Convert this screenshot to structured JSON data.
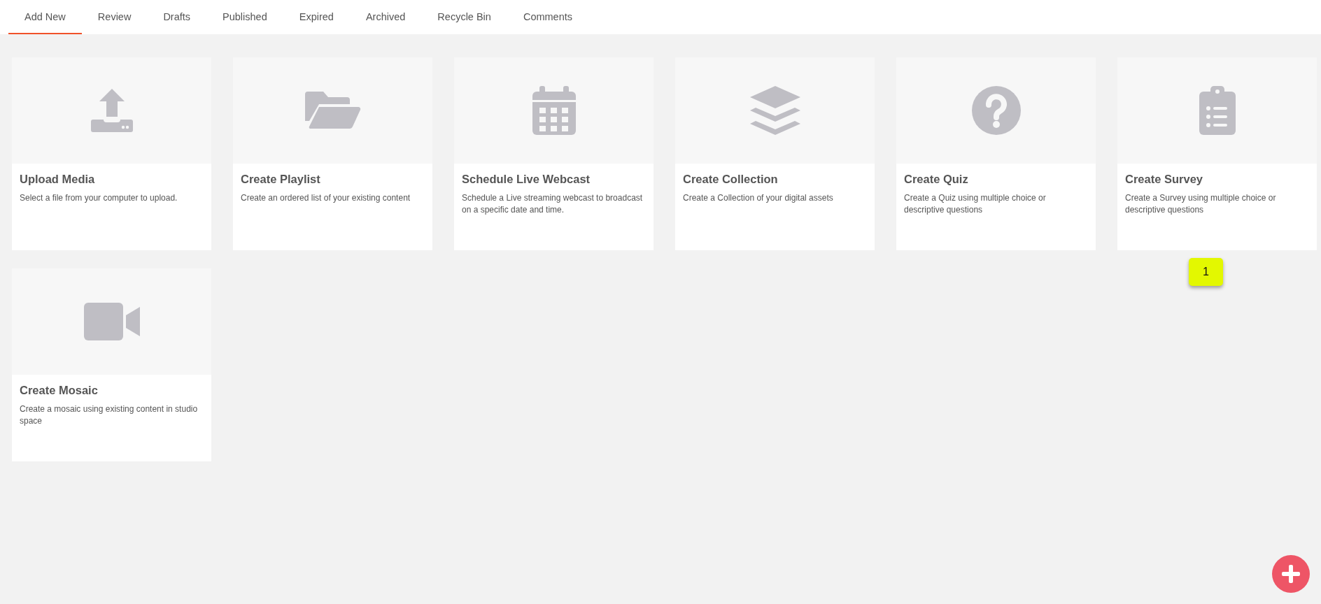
{
  "tabs": [
    {
      "label": "Add New",
      "selected": true
    },
    {
      "label": "Review",
      "selected": false
    },
    {
      "label": "Drafts",
      "selected": false
    },
    {
      "label": "Published",
      "selected": false
    },
    {
      "label": "Expired",
      "selected": false
    },
    {
      "label": "Archived",
      "selected": false
    },
    {
      "label": "Recycle Bin",
      "selected": false
    },
    {
      "label": "Comments",
      "selected": false
    }
  ],
  "cards": [
    {
      "kind": "upload",
      "title": "Upload Media",
      "description": "Select a file from your computer to upload."
    },
    {
      "kind": "folder",
      "title": "Create Playlist",
      "description": "Create an ordered list of your existing content"
    },
    {
      "kind": "calendar",
      "title": "Schedule Live Webcast",
      "description": "Schedule a Live streaming webcast to broadcast on a specific date and time."
    },
    {
      "kind": "layers",
      "title": "Create Collection",
      "description": "Create a Collection of your digital assets"
    },
    {
      "kind": "question",
      "title": "Create Quiz",
      "description": "Create a Quiz using multiple choice or descriptive questions"
    },
    {
      "kind": "clipboard",
      "title": "Create Survey",
      "description": "Create a Survey using multiple choice or descriptive questions"
    },
    {
      "kind": "video",
      "title": "Create Mosaic",
      "description": "Create a mosaic using existing content in studio space"
    }
  ],
  "step_badge": "1"
}
